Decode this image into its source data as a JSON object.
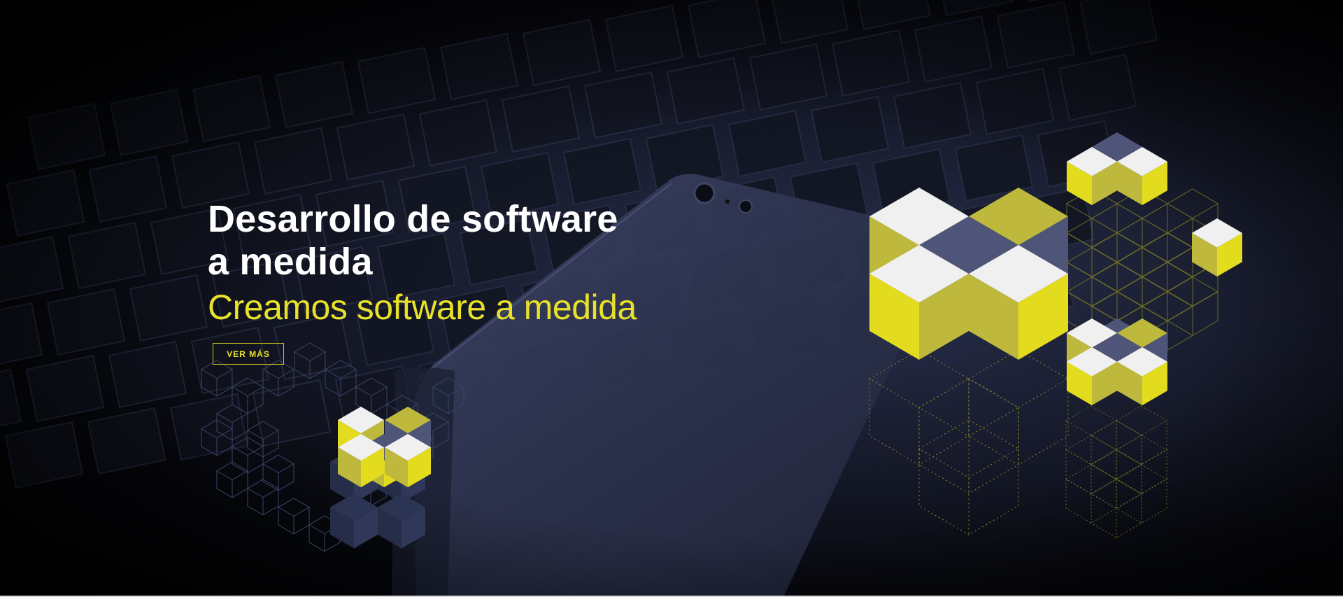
{
  "hero": {
    "title_line1": "Desarrollo de software",
    "title_line2": "a medida",
    "subtitle": "Creamos software a medida",
    "cta_label": "VER MÁS"
  },
  "icons": {
    "background": "keyboard-phone-photo-icon",
    "left_cubes": "isometric-cubes-icon",
    "right_cubes": "isometric-cubes-icon"
  },
  "colors": {
    "title": "#ffffff",
    "accent": "#e8e12a",
    "cube_white": "#f0f0f0",
    "cube_yellow": "#e3db1e",
    "cube_olive": "#beb93d",
    "cube_slate": "#4e5578",
    "background": "#000000"
  }
}
